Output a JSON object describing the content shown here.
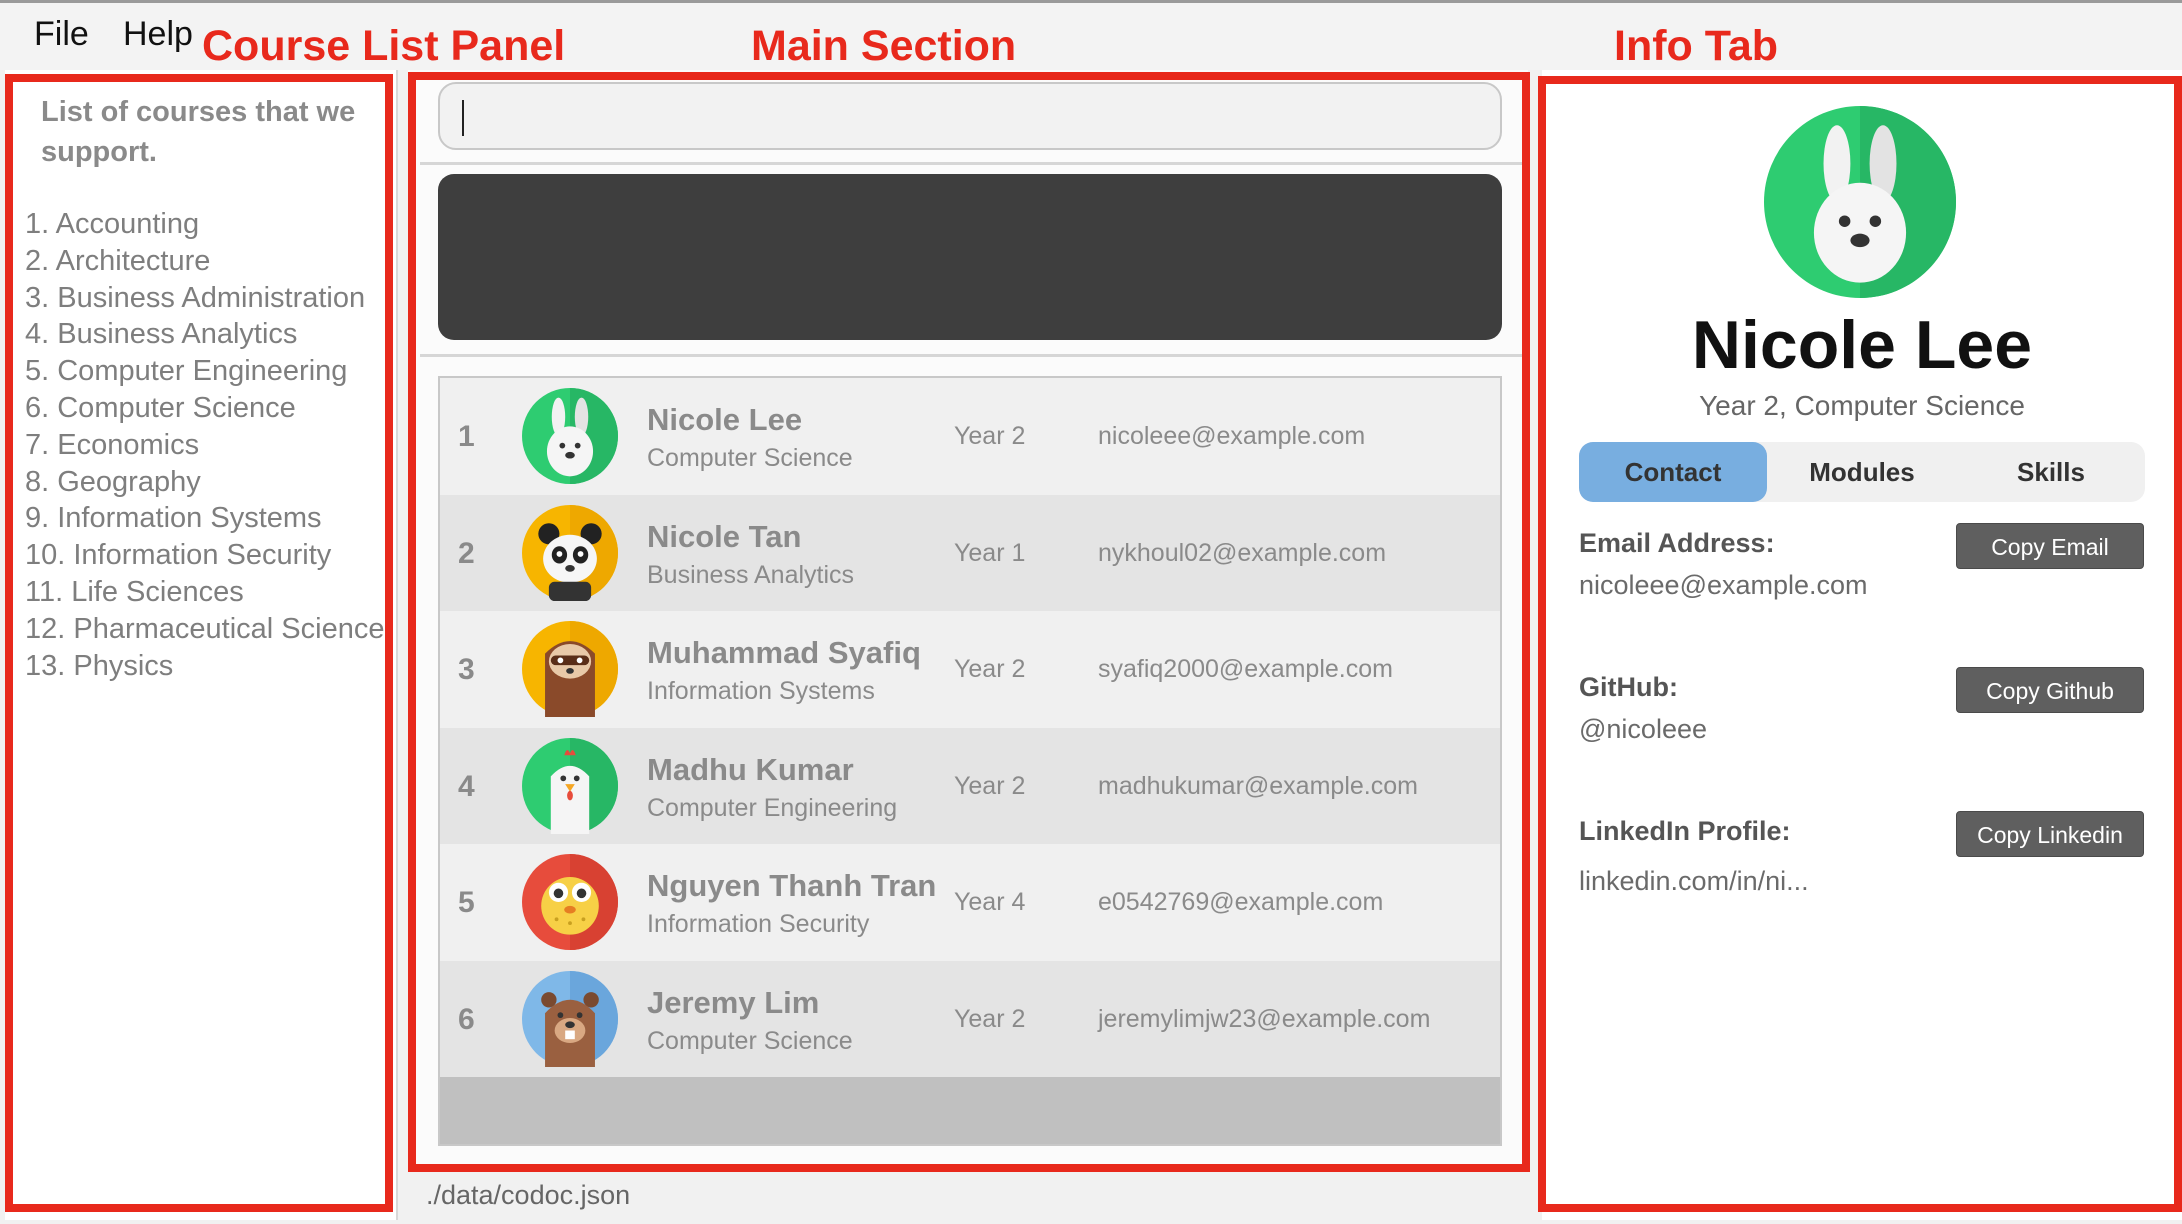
{
  "menu": {
    "file": "File",
    "help": "Help"
  },
  "callouts": {
    "course_list": "Course List Panel",
    "main": "Main Section",
    "info": "Info Tab"
  },
  "courses": {
    "title": "List of courses that we support.",
    "items": [
      "1. Accounting",
      "2. Architecture",
      "3. Business Administration",
      "4. Business Analytics",
      "5. Computer Engineering",
      "6. Computer Science",
      "7. Economics",
      "8. Geography",
      "9. Information Systems",
      "10. Information Security",
      "11. Life Sciences",
      "12. Pharmaceutical Science",
      "13. Physics"
    ]
  },
  "command": {
    "value": ""
  },
  "students": [
    {
      "index": "1",
      "name": "Nicole Lee",
      "course": "Computer Science",
      "year": "Year 2",
      "email": "nicoleee@example.com",
      "avatar": "bunny-icon"
    },
    {
      "index": "2",
      "name": "Nicole Tan",
      "course": "Business Analytics",
      "year": "Year 1",
      "email": "nykhoul02@example.com",
      "avatar": "panda-icon"
    },
    {
      "index": "3",
      "name": "Muhammad Syafiq",
      "course": "Information Systems",
      "year": "Year 2",
      "email": "syafiq2000@example.com",
      "avatar": "sloth-icon"
    },
    {
      "index": "4",
      "name": "Madhu Kumar",
      "course": "Computer Engineering",
      "year": "Year 2",
      "email": "madhukumar@example.com",
      "avatar": "chicken-icon"
    },
    {
      "index": "5",
      "name": "Nguyen Thanh Tran",
      "course": "Information Security",
      "year": "Year 4",
      "email": "e0542769@example.com",
      "avatar": "pufferfish-icon"
    },
    {
      "index": "6",
      "name": "Jeremy Lim",
      "course": "Computer Science",
      "year": "Year 2",
      "email": "jeremylimjw23@example.com",
      "avatar": "beaver-icon"
    }
  ],
  "footer": {
    "path": "./data/codoc.json"
  },
  "info": {
    "avatar": "bunny-icon",
    "name": "Nicole Lee",
    "subtitle": "Year 2, Computer Science",
    "tabs": {
      "contact": "Contact",
      "modules": "Modules",
      "skills": "Skills",
      "active": "Contact"
    },
    "email_label": "Email Address:",
    "email_value": "nicoleee@example.com",
    "email_button": "Copy Email",
    "github_label": "GitHub:",
    "github_value": "@nicoleee",
    "github_button": "Copy Github",
    "linkedin_label": "LinkedIn Profile:",
    "linkedin_value": "linkedin.com/in/ni...",
    "linkedin_button": "Copy Linkedin"
  },
  "colors": {
    "highlight": "#e8291c",
    "active_tab": "#78aee0",
    "result_box": "#3e3e3e",
    "button": "#5f5f5f"
  }
}
